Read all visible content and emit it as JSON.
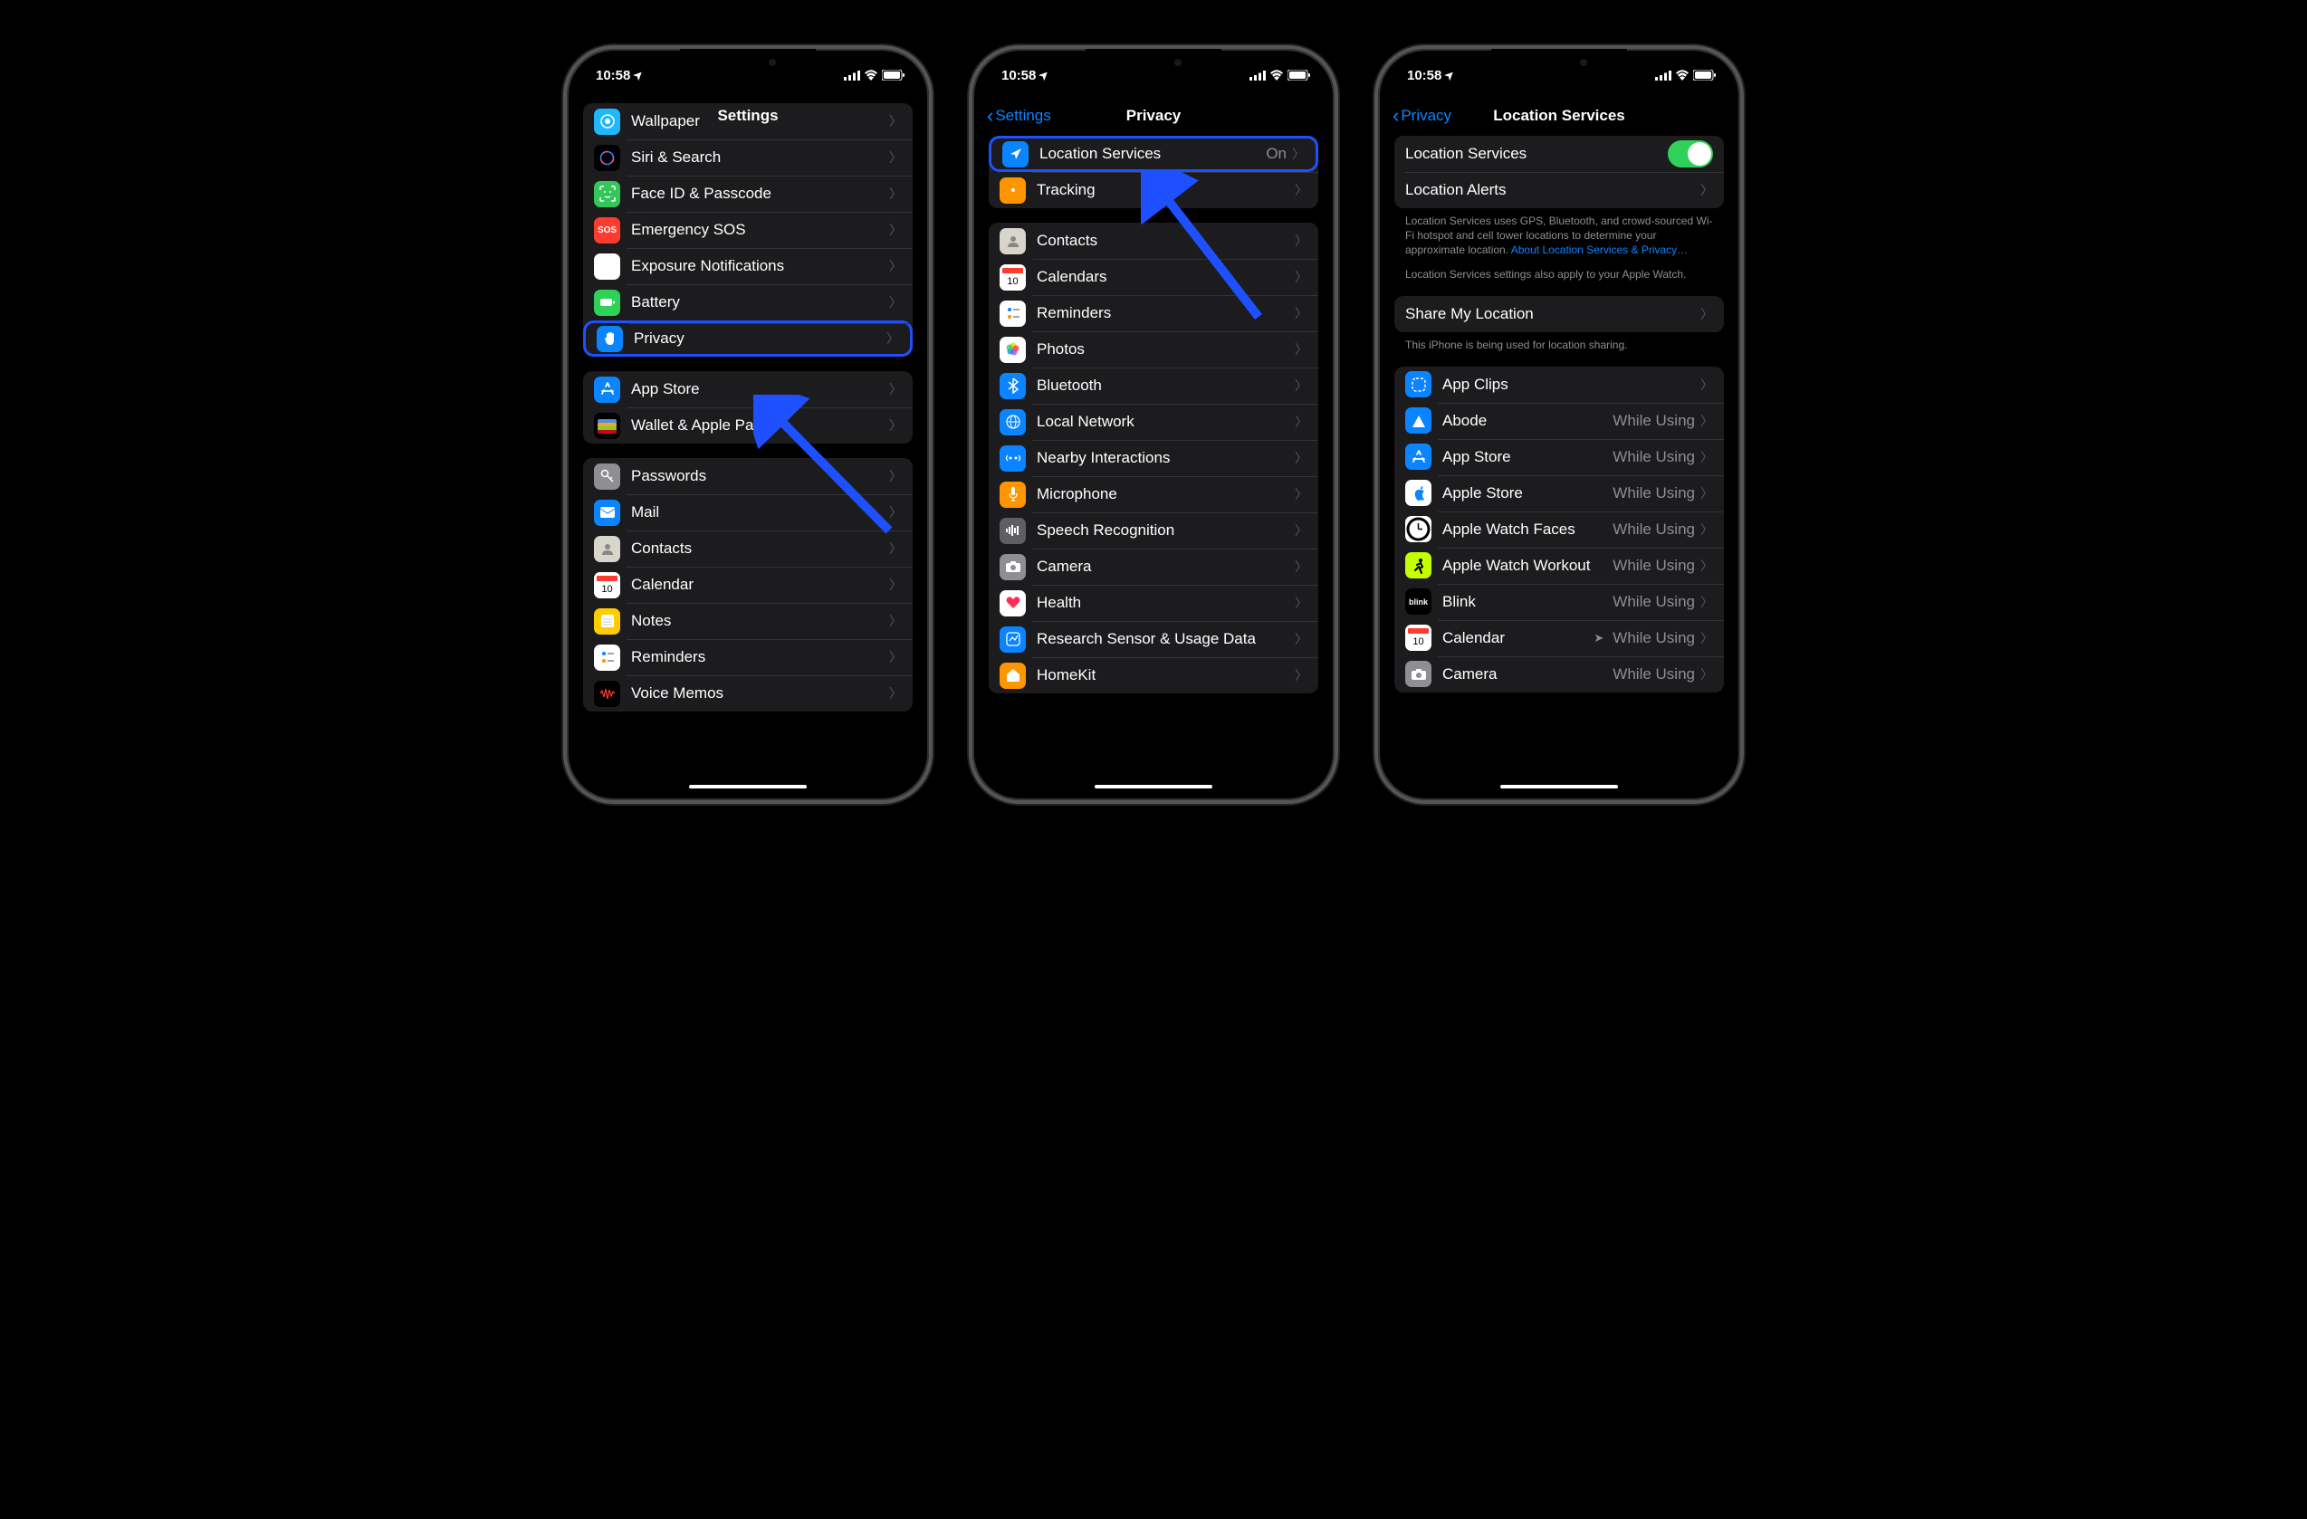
{
  "status": {
    "time": "10:58",
    "arrow": "➤"
  },
  "phone1": {
    "title": "Settings",
    "groups": [
      {
        "items": [
          {
            "id": "wallpaper",
            "label": "Wallpaper",
            "color": "#1fb8ff",
            "icon": "wallpaper",
            "chevron": true
          },
          {
            "id": "siri",
            "label": "Siri & Search",
            "color": "#000",
            "icon": "siri",
            "chevron": true
          },
          {
            "id": "faceid",
            "label": "Face ID & Passcode",
            "color": "#33c759",
            "icon": "faceid",
            "chevron": true
          },
          {
            "id": "sos",
            "label": "Emergency SOS",
            "color": "#ff3b30",
            "icon": "sos",
            "chevron": true
          },
          {
            "id": "exposure",
            "label": "Exposure Notifications",
            "color": "#ff3b30",
            "icon": "exposure",
            "chevron": true
          },
          {
            "id": "battery",
            "label": "Battery",
            "color": "#30d158",
            "icon": "battery",
            "chevron": true
          },
          {
            "id": "privacy",
            "label": "Privacy",
            "color": "#0b84ff",
            "icon": "hand",
            "chevron": true,
            "highlight": true
          }
        ]
      },
      {
        "items": [
          {
            "id": "appstore",
            "label": "App Store",
            "color": "#0b84ff",
            "icon": "appstore",
            "chevron": true
          },
          {
            "id": "wallet",
            "label": "Wallet & Apple Pay",
            "color": "#000",
            "icon": "wallet",
            "chevron": true
          }
        ]
      },
      {
        "items": [
          {
            "id": "passwords",
            "label": "Passwords",
            "color": "#8e8e93",
            "icon": "key",
            "chevron": true
          },
          {
            "id": "mail",
            "label": "Mail",
            "color": "#0b84ff",
            "icon": "mail",
            "chevron": true
          },
          {
            "id": "contacts",
            "label": "Contacts",
            "color": "#8e8e93",
            "icon": "contacts",
            "chevron": true
          },
          {
            "id": "calendar",
            "label": "Calendar",
            "color": "#fff",
            "icon": "calendar",
            "chevron": true
          },
          {
            "id": "notes",
            "label": "Notes",
            "color": "#ffcc00",
            "icon": "notes",
            "chevron": true
          },
          {
            "id": "reminders",
            "label": "Reminders",
            "color": "#fff",
            "icon": "reminders",
            "chevron": true
          },
          {
            "id": "voicememos",
            "label": "Voice Memos",
            "color": "#000",
            "icon": "voice",
            "chevron": true
          }
        ]
      }
    ]
  },
  "phone2": {
    "back": "Settings",
    "title": "Privacy",
    "groups": [
      {
        "items": [
          {
            "id": "location-services",
            "label": "Location Services",
            "value": "On",
            "color": "#0b84ff",
            "icon": "location",
            "chevron": true,
            "highlight": true
          },
          {
            "id": "tracking",
            "label": "Tracking",
            "color": "#ff9500",
            "icon": "tracking",
            "chevron": true
          }
        ]
      },
      {
        "items": [
          {
            "id": "p-contacts",
            "label": "Contacts",
            "color": "#d8d5ca",
            "icon": "contacts",
            "chevron": true
          },
          {
            "id": "p-calendars",
            "label": "Calendars",
            "color": "#fff",
            "icon": "calendar",
            "chevron": true
          },
          {
            "id": "p-reminders",
            "label": "Reminders",
            "color": "#fff",
            "icon": "reminders",
            "chevron": true
          },
          {
            "id": "p-photos",
            "label": "Photos",
            "color": "#fff",
            "icon": "photos",
            "chevron": true
          },
          {
            "id": "p-bluetooth",
            "label": "Bluetooth",
            "color": "#0b84ff",
            "icon": "bluetooth",
            "chevron": true
          },
          {
            "id": "p-localnet",
            "label": "Local Network",
            "color": "#0b84ff",
            "icon": "globe",
            "chevron": true
          },
          {
            "id": "p-nearby",
            "label": "Nearby Interactions",
            "color": "#0b84ff",
            "icon": "nearby",
            "chevron": true
          },
          {
            "id": "p-mic",
            "label": "Microphone",
            "color": "#ff9500",
            "icon": "mic",
            "chevron": true
          },
          {
            "id": "p-speech",
            "label": "Speech Recognition",
            "color": "#5e5e64",
            "icon": "speech",
            "chevron": true
          },
          {
            "id": "p-camera",
            "label": "Camera",
            "color": "#8e8e93",
            "icon": "camera",
            "chevron": true
          },
          {
            "id": "p-health",
            "label": "Health",
            "color": "#fff",
            "icon": "health",
            "chevron": true
          },
          {
            "id": "p-research",
            "label": "Research Sensor & Usage Data",
            "color": "#0b84ff",
            "icon": "research",
            "chevron": true
          },
          {
            "id": "p-homekit",
            "label": "HomeKit",
            "color": "#ff9500",
            "icon": "home",
            "chevron": true
          }
        ]
      }
    ]
  },
  "phone3": {
    "back": "Privacy",
    "title": "Location Services",
    "groups": [
      {
        "items": [
          {
            "id": "loc-toggle",
            "label": "Location Services",
            "toggle": true,
            "no_icon": true
          },
          {
            "id": "loc-alerts",
            "label": "Location Alerts",
            "chevron": true,
            "no_icon": true
          }
        ],
        "footer": "Location Services uses GPS, Bluetooth, and crowd-sourced Wi-Fi hotspot and cell tower locations to determine your approximate location. ",
        "footer_link": "About Location Services & Privacy…",
        "footer2": "Location Services settings also apply to your Apple Watch."
      },
      {
        "items": [
          {
            "id": "share-loc",
            "label": "Share My Location",
            "chevron": true,
            "no_icon": true
          }
        ],
        "footer": "This iPhone is being used for location sharing."
      },
      {
        "items": [
          {
            "id": "app-clips",
            "label": "App Clips",
            "color": "#0b84ff",
            "icon": "appclips",
            "chevron": true
          },
          {
            "id": "abode",
            "label": "Abode",
            "value": "While Using",
            "color": "#0b84ff",
            "icon": "abode",
            "chevron": true
          },
          {
            "id": "app-store-loc",
            "label": "App Store",
            "value": "While Using",
            "color": "#0b84ff",
            "icon": "appstore",
            "chevron": true
          },
          {
            "id": "apple-store",
            "label": "Apple Store",
            "value": "While Using",
            "color": "#fff",
            "icon": "applestore",
            "chevron": true
          },
          {
            "id": "watch-faces",
            "label": "Apple Watch Faces",
            "value": "While Using",
            "color": "#fff",
            "icon": "watch",
            "chevron": true
          },
          {
            "id": "watch-workout",
            "label": "Apple Watch Workout",
            "value": "While Using",
            "color": "#c3ff00",
            "icon": "workout",
            "chevron": true
          },
          {
            "id": "blink",
            "label": "Blink",
            "value": "While Using",
            "color": "#000",
            "icon": "blink",
            "chevron": true
          },
          {
            "id": "calendar-loc",
            "label": "Calendar",
            "value": "While Using",
            "loc_arrow": true,
            "color": "#fff",
            "icon": "calendar",
            "chevron": true
          },
          {
            "id": "camera-loc",
            "label": "Camera",
            "value": "While Using",
            "color": "#8e8e93",
            "icon": "camera",
            "chevron": true
          }
        ]
      }
    ]
  }
}
